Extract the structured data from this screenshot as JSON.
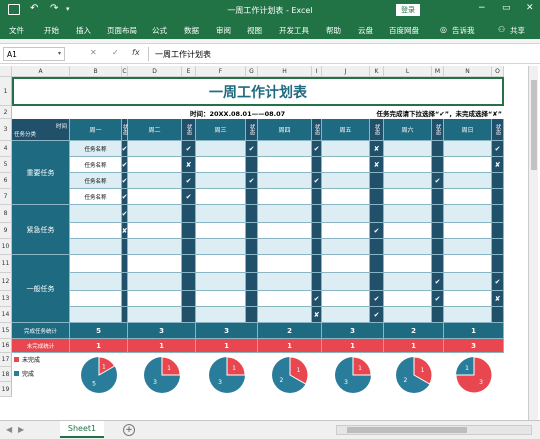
{
  "window": {
    "title": "一周工作计划表 - Excel",
    "login": "登录",
    "minimize": "−",
    "restore": "▭",
    "close": "✕",
    "undo": "↶",
    "redo": "↷",
    "qat": "▾"
  },
  "ribbon": {
    "tabs": [
      "文件",
      "开始",
      "插入",
      "页面布局",
      "公式",
      "数据",
      "审阅",
      "视图",
      "开发工具",
      "帮助",
      "云盘",
      "百度网盘"
    ],
    "tell_me": "告诉我",
    "share": "共享"
  },
  "formula_bar": {
    "name_box": "A1",
    "content": "一周工作计划表",
    "cancel": "✕",
    "enter": "✓",
    "fx": "fx"
  },
  "columns": [
    "A",
    "B",
    "C",
    "D",
    "E",
    "F",
    "G",
    "H",
    "I",
    "J",
    "K",
    "L",
    "M",
    "N",
    "O"
  ],
  "rows": [
    "1",
    "2",
    "3",
    "4",
    "5",
    "6",
    "7",
    "8",
    "9",
    "10",
    "11",
    "12",
    "13",
    "14",
    "15",
    "16",
    "17",
    "18",
    "19"
  ],
  "sheet": {
    "title": "一周工作计划表",
    "time": "时间：20XX.08.01——08.07",
    "hint": "任务完成请下拉选择“✔”，未完成选择“✘”",
    "corner_top": "时间",
    "corner_bottom": "任务分类",
    "days": [
      "周一",
      "周二",
      "周三",
      "周四",
      "周五",
      "周六",
      "周日"
    ],
    "status_label": "状态",
    "categories": [
      "重要任务",
      "紧急任务",
      "一般任务"
    ],
    "task_name": "任务名称",
    "status_marks": [
      [
        "✔",
        "✔",
        "✔",
        "✔",
        "✘",
        "",
        "✔"
      ],
      [
        "✔",
        "✘",
        "",
        "",
        "✘",
        "",
        "✘"
      ],
      [
        "✔",
        "✔",
        "✔",
        "✔",
        "",
        "✔",
        ""
      ],
      [
        "✔",
        "✔",
        "",
        "",
        "",
        "",
        ""
      ],
      [
        "✔",
        "",
        "",
        "",
        "",
        "",
        ""
      ],
      [
        "✘",
        "",
        "",
        "",
        "✔",
        "",
        ""
      ],
      [
        "",
        "",
        "",
        "",
        "",
        "",
        ""
      ],
      [
        "",
        "",
        "",
        "",
        "",
        "",
        ""
      ],
      [
        "",
        "",
        "",
        "",
        "",
        "✔",
        "✔"
      ],
      [
        "",
        "",
        "",
        "✔",
        "✔",
        "✔",
        "✘"
      ],
      [
        "",
        "",
        "",
        "✘",
        "✔",
        "",
        ""
      ]
    ],
    "done_label": "完成任务统计",
    "done_counts": [
      "5",
      "3",
      "3",
      "2",
      "3",
      "2",
      "1"
    ],
    "undone_label": "未完成统计",
    "undone_counts": [
      "1",
      "1",
      "1",
      "1",
      "1",
      "1",
      "3"
    ],
    "legend_undone": "未完成",
    "legend_done": "完成",
    "legend_colors": {
      "undone": "#e8474f",
      "done": "#2a7d9a"
    }
  },
  "tabs": {
    "sheet": "Sheet1",
    "add": "+"
  }
}
